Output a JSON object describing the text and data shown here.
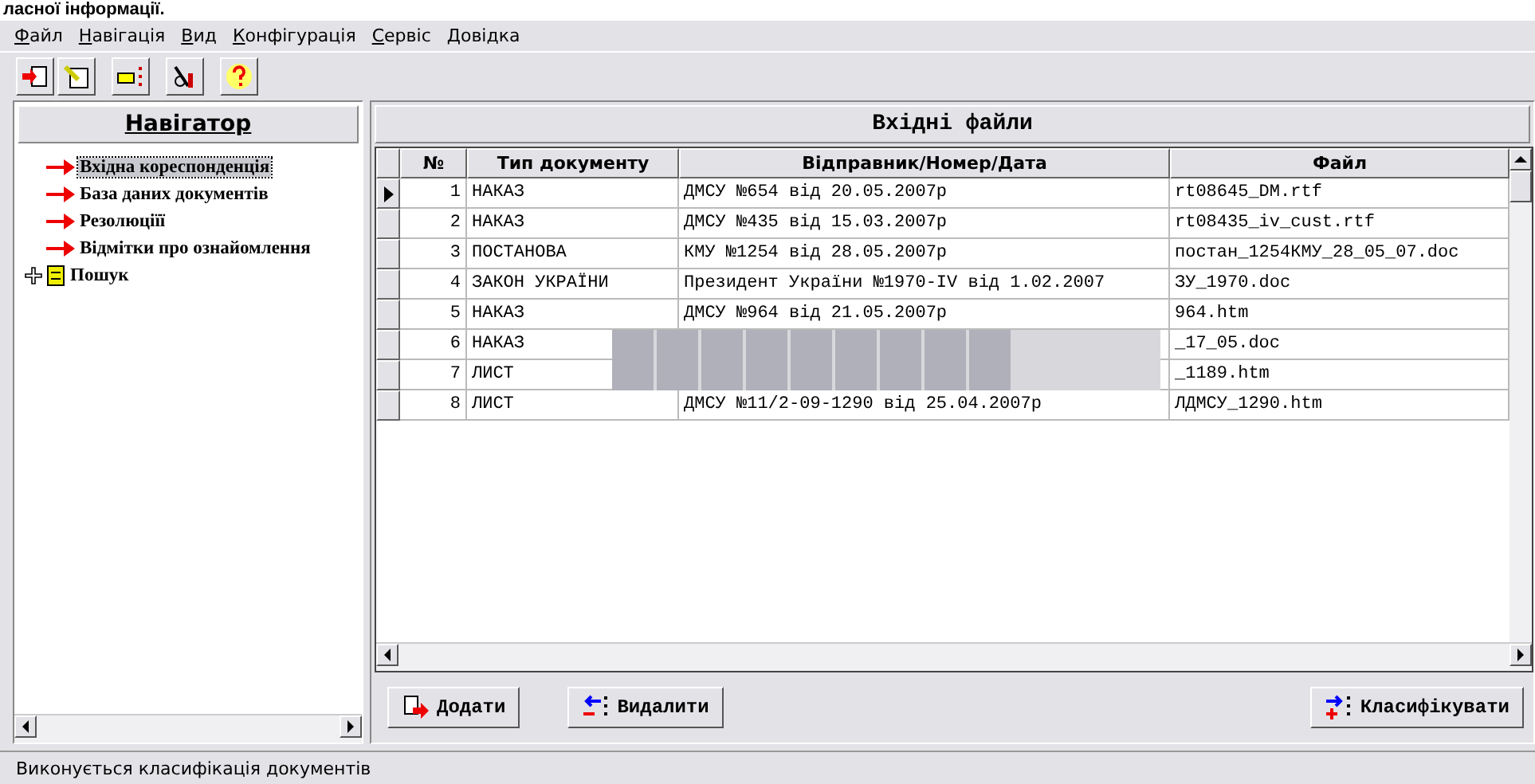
{
  "top_caption": "ласної інформації.",
  "menu": [
    "Файл",
    "Навігація",
    "Вид",
    "Конфігурація",
    "Сервіс",
    "Довідка"
  ],
  "toolbar": [
    {
      "kind": "import"
    },
    {
      "kind": "edit"
    },
    {
      "kind": "point"
    },
    {
      "kind": "tools"
    },
    {
      "kind": "help"
    }
  ],
  "navigator": {
    "title": "Навігатор",
    "items": [
      {
        "label": "Вхідна кореспонденція",
        "kind": "leaf",
        "selected": true
      },
      {
        "label": "База даних документів",
        "kind": "leaf",
        "selected": false
      },
      {
        "label": "Резолюціїї",
        "kind": "leaf",
        "selected": false
      },
      {
        "label": "Відмітки про ознайомлення",
        "kind": "leaf",
        "selected": false
      },
      {
        "label": "Пошук",
        "kind": "folder",
        "expanded": false,
        "selected": false
      }
    ]
  },
  "files": {
    "title": "Вхідні файли",
    "columns": [
      "№",
      "Тип документу",
      "Відправник/Номер/Дата",
      "Файл"
    ],
    "rows": [
      {
        "no": "1",
        "type": "НАКАЗ",
        "sender": "ДМСУ №654 від 20.05.2007р",
        "file": "rt08645_DM.rtf",
        "selected": true
      },
      {
        "no": "2",
        "type": "НАКАЗ",
        "sender": "ДМСУ №435 від 15.03.2007р",
        "file": "rt08435_iv_cust.rtf",
        "selected": false
      },
      {
        "no": "3",
        "type": "ПОСТАНОВА",
        "sender": "КМУ №1254 від 28.05.2007р",
        "file": "постан_1254КМУ_28_05_07.doc",
        "selected": false
      },
      {
        "no": "4",
        "type": "ЗАКОН УКРАЇНИ",
        "sender": "Президент України №1970-IV від 1.02.2007",
        "file": "ЗУ_1970.doc",
        "selected": false
      },
      {
        "no": "5",
        "type": "НАКАЗ",
        "sender": "ДМСУ №964 від 21.05.2007р",
        "file": "964.htm",
        "selected": false
      },
      {
        "no": "6",
        "type": "НАКАЗ",
        "file": "_17_05.doc",
        "selected": false,
        "redacted": true
      },
      {
        "no": "7",
        "type": "ЛИСТ",
        "file": "_1189.htm",
        "selected": false,
        "redacted": true
      },
      {
        "no": "8",
        "type": "ЛИСТ",
        "sender": "ДМСУ №11/2-09-1290 від 25.04.2007р",
        "file": "ЛДМСУ_1290.htm",
        "selected": false
      }
    ]
  },
  "buttons": [
    {
      "label": "Додати",
      "kind": "add"
    },
    {
      "label": "Видалити",
      "kind": "remove"
    },
    {
      "label": "Класифікувати",
      "kind": "classify"
    }
  ],
  "status_bar": "Виконується класифікація документів"
}
